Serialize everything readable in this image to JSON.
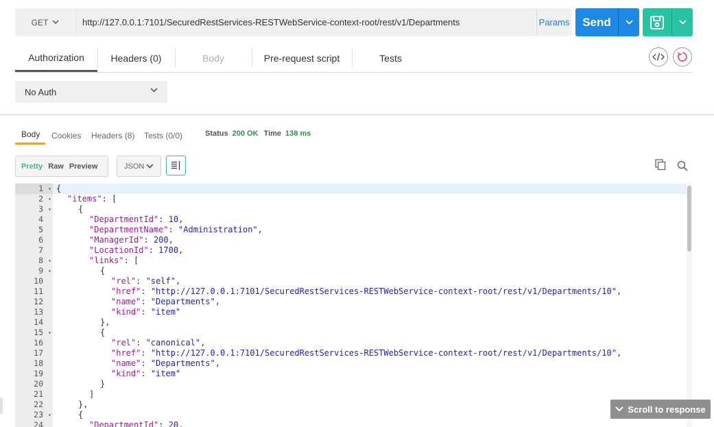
{
  "request": {
    "method": "GET",
    "url": "http://127.0.0.1:7101/SecuredRestServices-RESTWebService-context-root/rest/v1/Departments",
    "params_label": "Params",
    "send_label": "Send"
  },
  "request_tabs": [
    {
      "label": "Authorization",
      "active": true,
      "disabled": false
    },
    {
      "label": "Headers (0)",
      "active": false,
      "disabled": false
    },
    {
      "label": "Body",
      "active": false,
      "disabled": true
    },
    {
      "label": "Pre-request script",
      "active": false,
      "disabled": false
    },
    {
      "label": "Tests",
      "active": false,
      "disabled": false
    }
  ],
  "auth": {
    "selected": "No Auth"
  },
  "response_tabs": [
    {
      "label": "Body",
      "active": true
    },
    {
      "label": "Cookies",
      "active": false
    },
    {
      "label": "Headers (8)",
      "active": false
    },
    {
      "label": "Tests (0/0)",
      "active": false
    }
  ],
  "status": {
    "status_label": "Status",
    "status_value": "200 OK",
    "time_label": "Time",
    "time_value": "138 ms"
  },
  "view": {
    "modes": [
      "Pretty",
      "Raw",
      "Preview"
    ],
    "active_mode": "Pretty",
    "format": "JSON"
  },
  "code_lines": [
    {
      "n": "1",
      "fold": true
    },
    {
      "n": "2",
      "fold": true
    },
    {
      "n": "3",
      "fold": true
    },
    {
      "n": "4",
      "fold": false
    },
    {
      "n": "5",
      "fold": false
    },
    {
      "n": "6",
      "fold": false
    },
    {
      "n": "7",
      "fold": false
    },
    {
      "n": "8",
      "fold": true
    },
    {
      "n": "9",
      "fold": true
    },
    {
      "n": "10",
      "fold": false
    },
    {
      "n": "11",
      "fold": false
    },
    {
      "n": "12",
      "fold": false
    },
    {
      "n": "13",
      "fold": false
    },
    {
      "n": "14",
      "fold": false
    },
    {
      "n": "15",
      "fold": true
    },
    {
      "n": "16",
      "fold": false
    },
    {
      "n": "17",
      "fold": false
    },
    {
      "n": "18",
      "fold": false
    },
    {
      "n": "19",
      "fold": false
    },
    {
      "n": "20",
      "fold": false
    },
    {
      "n": "21",
      "fold": false
    },
    {
      "n": "22",
      "fold": false
    },
    {
      "n": "23",
      "fold": true
    },
    {
      "n": "24",
      "fold": false
    }
  ],
  "code": {
    "l1": "{",
    "l2_key": "\"items\"",
    "l2_rest": ": [",
    "l3": "{",
    "l4_key": "\"DepartmentId\"",
    "l4_val": "10",
    "l5_key": "\"DepartmentName\"",
    "l5_val": "\"Administration\"",
    "l6_key": "\"ManagerId\"",
    "l6_val": "200",
    "l7_key": "\"LocationId\"",
    "l7_val": "1700",
    "l8_key": "\"links\"",
    "l8_rest": ": [",
    "l9": "{",
    "l10_key": "\"rel\"",
    "l10_val": "\"self\"",
    "l11_key": "\"href\"",
    "l11_val": "\"http://127.0.0.1:7101/SecuredRestServices-RESTWebService-context-root/rest/v1/Departments/10\"",
    "l12_key": "\"name\"",
    "l12_val": "\"Departments\"",
    "l13_key": "\"kind\"",
    "l13_val": "\"item\"",
    "l14": "},",
    "l15": "{",
    "l16_key": "\"rel\"",
    "l16_val": "\"canonical\"",
    "l17_key": "\"href\"",
    "l17_val": "\"http://127.0.0.1:7101/SecuredRestServices-RESTWebService-context-root/rest/v1/Departments/10\"",
    "l18_key": "\"name\"",
    "l18_val": "\"Departments\"",
    "l19_key": "\"kind\"",
    "l19_val": "\"item\"",
    "l20": "}",
    "l21": "]",
    "l22": "},",
    "l23": "{",
    "l24_key": "\"DepartmentId\"",
    "l24_val": "20"
  },
  "scroll_to_response_label": "Scroll to response",
  "colors": {
    "send": "#1e88e5",
    "save": "#26c4a2",
    "status_ok": "#27964e",
    "active_response_tab": "#e8a33d"
  }
}
